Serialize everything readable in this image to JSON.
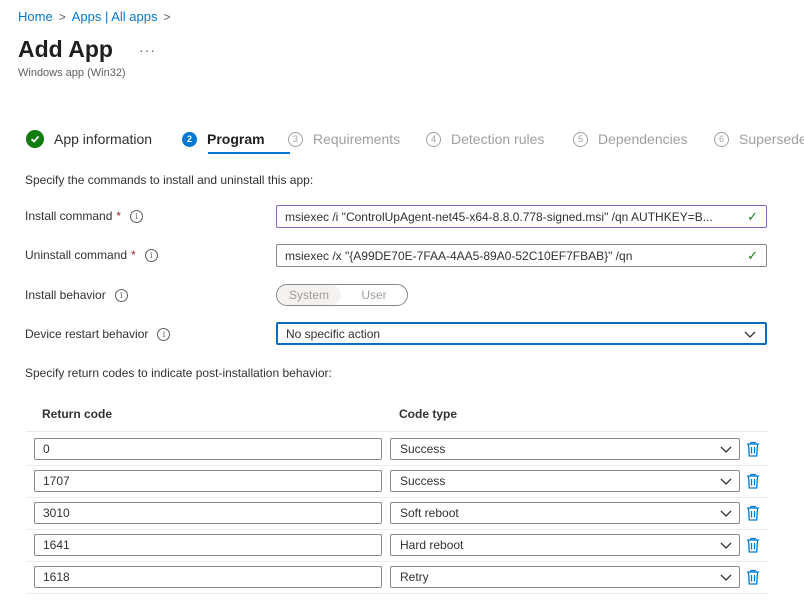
{
  "breadcrumb": {
    "home": "Home",
    "apps": "Apps | All apps"
  },
  "page": {
    "title": "Add App",
    "more": "···",
    "subtitle": "Windows app (Win32)"
  },
  "steps": [
    {
      "num": "✓",
      "label": "App information",
      "state": "done"
    },
    {
      "num": "2",
      "label": "Program",
      "state": "active"
    },
    {
      "num": "3",
      "label": "Requirements",
      "state": "pending"
    },
    {
      "num": "4",
      "label": "Detection rules",
      "state": "pending"
    },
    {
      "num": "5",
      "label": "Dependencies",
      "state": "pending"
    },
    {
      "num": "6",
      "label": "Supersedence",
      "state": "pending"
    }
  ],
  "program": {
    "intro": "Specify the commands to install and uninstall this app:",
    "install_label": "Install command",
    "install_value": "msiexec /i \"ControlUpAgent-net45-x64-8.8.0.778-signed.msi\" /qn AUTHKEY=B...",
    "uninstall_label": "Uninstall command",
    "uninstall_value": "msiexec /x \"{A99DE70E-7FAA-4AA5-89A0-52C10EF7FBAB}\" /qn",
    "behavior_label": "Install behavior",
    "behavior_options": {
      "system": "System",
      "user": "User"
    },
    "restart_label": "Device restart behavior",
    "restart_value": "No specific action",
    "required_marker": "*"
  },
  "return_codes": {
    "intro": "Specify return codes to indicate post-installation behavior:",
    "col_code": "Return code",
    "col_type": "Code type",
    "rows": [
      {
        "code": "0",
        "type": "Success"
      },
      {
        "code": "1707",
        "type": "Success"
      },
      {
        "code": "3010",
        "type": "Soft reboot"
      },
      {
        "code": "1641",
        "type": "Hard reboot"
      },
      {
        "code": "1618",
        "type": "Retry"
      }
    ]
  },
  "colors": {
    "accent": "#0078d4",
    "success": "#107c10",
    "required": "#a4262c"
  }
}
